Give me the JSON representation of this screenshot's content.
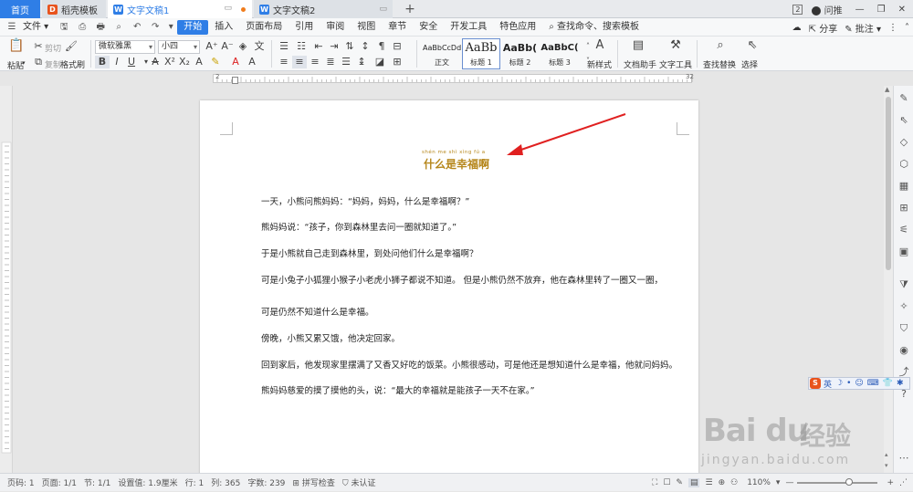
{
  "tabs": {
    "home": "首页",
    "straw": "稻壳模板",
    "doc1": "文字文稿1",
    "doc2": "文字文稿2",
    "plus": "+"
  },
  "window": {
    "badge": "2",
    "user": "问推",
    "minimize": "—",
    "restore": "❐",
    "close": "✕"
  },
  "menubar": {
    "file": "文件",
    "items": [
      "开始",
      "插入",
      "页面布局",
      "引用",
      "审阅",
      "视图",
      "章节",
      "安全",
      "开发工具",
      "特色应用"
    ],
    "active_index": 0,
    "search": "查找命令、搜索模板",
    "share": "分享",
    "comment": "批注"
  },
  "ribbon": {
    "paste": "粘贴",
    "cut": "剪切",
    "copy": "复制",
    "format_painter": "格式刷",
    "font_name": "微软雅黑",
    "font_size": "小四",
    "styles": [
      {
        "sample": "AaBbCcDd",
        "label": "正文"
      },
      {
        "sample": "AaBb",
        "label": "标题 1"
      },
      {
        "sample": "AaBb(",
        "label": "标题 2"
      },
      {
        "sample": "AaBbC(",
        "label": "标题 3"
      }
    ],
    "new_style": "新样式",
    "doc_assistant": "文档助手",
    "text_tools": "文字工具",
    "find_replace": "查找替换",
    "select": "选择"
  },
  "ruler": {
    "left_number": "2",
    "right_number": "32"
  },
  "document": {
    "pinyin": "shén me shì xìng fú a",
    "title": "什么是幸福啊",
    "paragraphs": [
      "一天，小熊问熊妈妈：“妈妈，妈妈，什么是幸福啊？”",
      "熊妈妈说：“孩子，你到森林里去问一圈就知道了。”",
      "于是小熊就自己走到森林里，到处问他们什么是幸福啊？",
      "可是小兔子小狐狸小猴子小老虎小狮子都说不知道。 但是小熊仍然不放弃，他在森林里转了一圈又一圈，",
      "可是仍然不知道什么是幸福。",
      "傍晚，小熊又累又饿，他决定回家。",
      "回到家后，他发现家里摆满了又香又好吃的饭菜。小熊很感动，可是他还是想知道什么是幸福，他就问妈妈。",
      "熊妈妈慈爱的摸了摸他的头，说：“最大的幸福就是能孩子一天不在家。”"
    ]
  },
  "statusbar": {
    "page_num": "页码: 1",
    "pages": "页面: 1/1",
    "section": "节: 1/1",
    "setting": "设置值: 1.9厘米",
    "row": "行: 1",
    "col": "列: 365",
    "words": "字数: 239",
    "spell": "拼写检查",
    "cert": "未认证",
    "zoom": "110%",
    "zoom_fraction": 0.64
  },
  "ime": {
    "logo": "S",
    "lang": "英"
  },
  "watermark": {
    "logo": "Bai du",
    "cn": "经验",
    "url": "jingyan.baidu.com"
  },
  "colors": {
    "accent": "#2f7ee6",
    "title": "#b6871c",
    "arrow": "#e02020"
  }
}
